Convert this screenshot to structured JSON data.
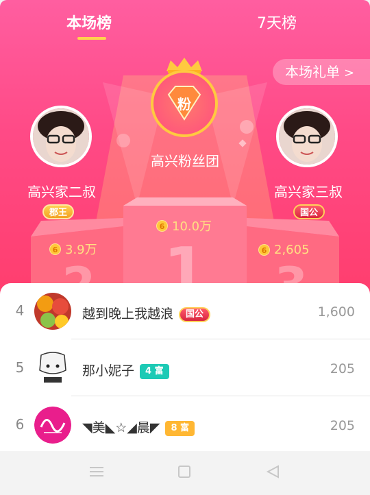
{
  "tabs": [
    {
      "label": "本场榜",
      "active": true
    },
    {
      "label": "7天榜",
      "active": false
    }
  ],
  "gift_list_button": {
    "label": "本场礼单",
    "icon": "chevron-right-icon"
  },
  "podium": {
    "first": {
      "name": "高兴粉丝团",
      "score": "10.0万",
      "medal_text": "粉",
      "icon": "crown-icon"
    },
    "second": {
      "name": "高兴家二叔",
      "title_badge": "郡王",
      "score": "3.9万"
    },
    "third": {
      "name": "高兴家三叔",
      "title_badge": "国公",
      "score": "2,605"
    }
  },
  "ranking": [
    {
      "rank": "4",
      "name": "越到晚上我越浪",
      "badge": "国公",
      "score": "1,600"
    },
    {
      "rank": "5",
      "name": "那小妮子",
      "badge": "4 富",
      "score": "205"
    },
    {
      "rank": "6",
      "name": "◥美◣☆◢晨◤",
      "badge": "8 富",
      "score": "205"
    }
  ],
  "navbar": {
    "menu_icon": "menu-icon",
    "home_icon": "square-home-icon",
    "back_icon": "triangle-back-icon"
  },
  "colors": {
    "accent": "#ff4a86",
    "gold": "#ffd34d",
    "teal_badge": "#1ccab5",
    "orange_badge": "#ffb733"
  }
}
